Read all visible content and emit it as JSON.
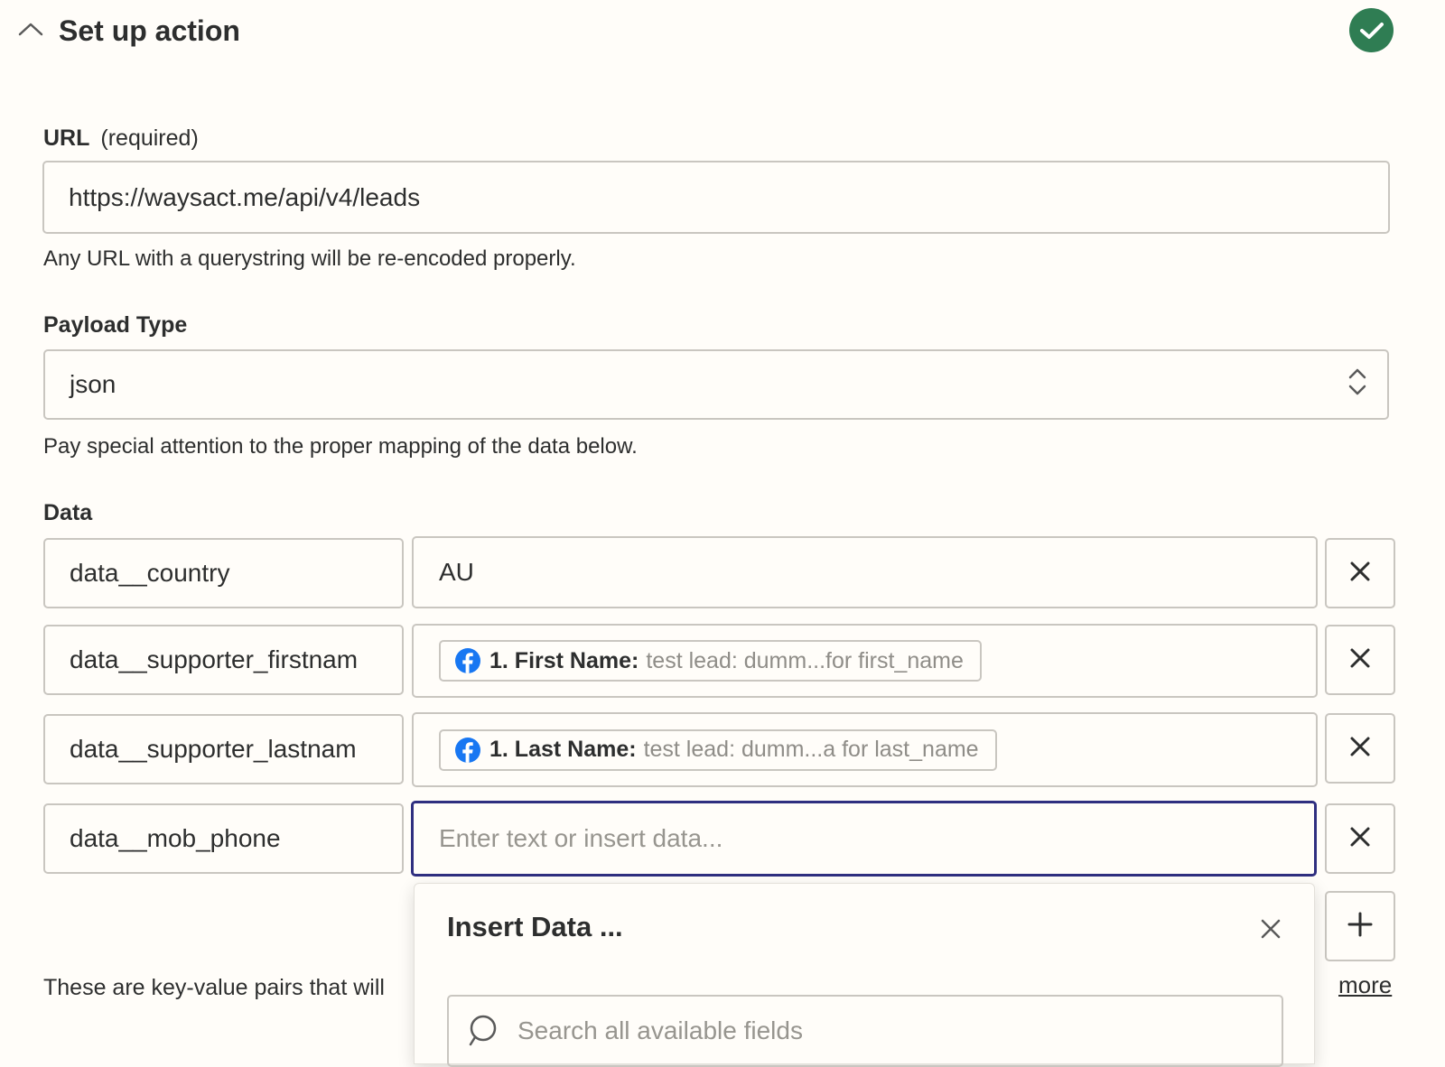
{
  "header": {
    "title": "Set up action"
  },
  "url_field": {
    "label": "URL",
    "required_label": "(required)",
    "value": "https://waysact.me/api/v4/leads",
    "help": "Any URL with a querystring will be re-encoded properly."
  },
  "payload_field": {
    "label": "Payload Type",
    "value": "json",
    "help": "Pay special attention to the proper mapping of the data below."
  },
  "data_field": {
    "label": "Data",
    "rows": [
      {
        "key": "data__country",
        "value": "AU"
      },
      {
        "key": "data__supporter_firstnam",
        "pill_label": "1. First Name:",
        "pill_value": "test lead: dumm...for first_name"
      },
      {
        "key": "data__supporter_lastnam",
        "pill_label": "1. Last Name:",
        "pill_value": "test lead: dumm...a for last_name"
      },
      {
        "key": "data__mob_phone",
        "placeholder": "Enter text or insert data..."
      }
    ],
    "help": "These are key-value pairs that will",
    "more_link": "more"
  },
  "insert_popup": {
    "title": "Insert Data ...",
    "search_placeholder": "Search all available fields"
  },
  "colors": {
    "success": "#2f7d53",
    "focus_border": "#2f2f80",
    "facebook": "#1877f2",
    "background": "#fffdf9"
  },
  "icons": {
    "collapse": "chevron-up-icon",
    "status": "check-circle-icon",
    "select": "up-down-chevron-icon",
    "remove": "close-icon",
    "add": "plus-icon",
    "source": "facebook-icon",
    "search": "search-icon"
  }
}
